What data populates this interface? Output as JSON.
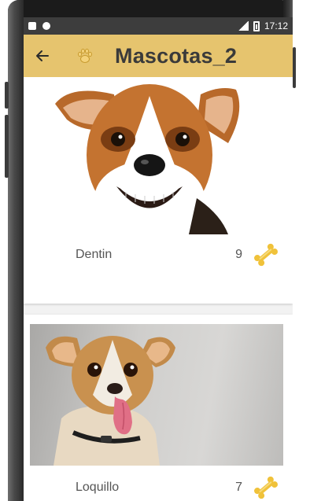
{
  "status_bar": {
    "time": "17:12",
    "left_icons": [
      "sd-card-icon",
      "android-icon"
    ],
    "right_icons": [
      "signal-icon",
      "battery-icon"
    ]
  },
  "app_bar": {
    "title": "Mascotas_2",
    "background_color": "#e6c46e",
    "back_icon": "arrow-left-icon",
    "logo_icon": "paw-icon"
  },
  "pets": [
    {
      "name": "Dentin",
      "likes": "9",
      "like_icon": "bone-icon",
      "photo": "dog-photo-smiling"
    },
    {
      "name": "Loquillo",
      "likes": "7",
      "like_icon": "bone-icon",
      "photo": "dog-photo-tongue-out"
    }
  ],
  "colors": {
    "accent": "#e6c46e",
    "bone": "#f0c23a",
    "text": "#555555"
  }
}
